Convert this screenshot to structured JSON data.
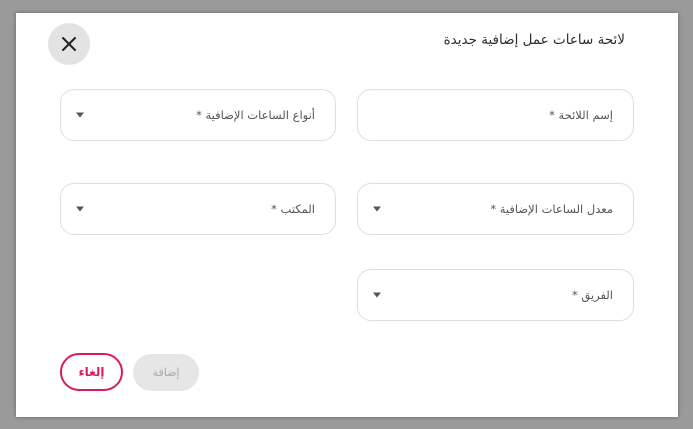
{
  "dialog": {
    "title": "لائحة ساعات عمل إضافية جديدة",
    "close_icon": "close-icon"
  },
  "fields": {
    "policy_name": {
      "label": "إسم اللائحة *"
    },
    "overtime_types": {
      "label": "أنواع الساعات الإضافية *",
      "icon": "chevron-down-icon"
    },
    "overtime_rate": {
      "label": "معدل الساعات الإضافية *",
      "icon": "chevron-down-icon"
    },
    "office": {
      "label": "المكتب *",
      "icon": "chevron-down-icon"
    },
    "team": {
      "label": "الفريق *",
      "icon": "chevron-down-icon"
    }
  },
  "buttons": {
    "cancel_label": "إلغاء",
    "add_label": "إضافة"
  },
  "colors": {
    "accent": "#d81b60",
    "disabled_bg": "#e6e6e6",
    "disabled_text": "#a9a9a9"
  }
}
